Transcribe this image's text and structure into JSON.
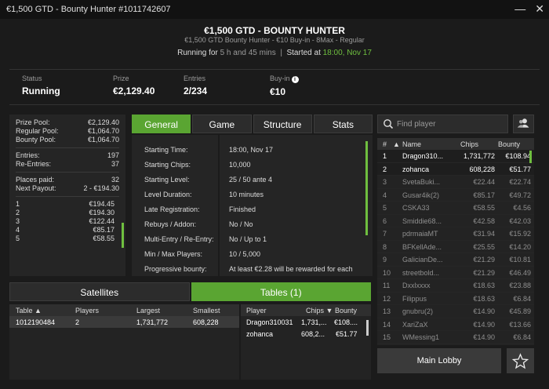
{
  "window": {
    "title": "€1,500 GTD - Bounty Hunter #1011742607",
    "minimize": "—",
    "close": "✕"
  },
  "header": {
    "title": "€1,500 GTD - BOUNTY HUNTER",
    "subtitle": "€1,500 GTD Bounty Hunter - €10 Buy-in - 8Max - Regular",
    "running_label": "Running for",
    "running_value": "5 h and 45 mins",
    "separator": "|",
    "started_label": "Started at",
    "started_value": "18:00, Nov 17"
  },
  "stats": [
    {
      "label": "Status",
      "value": "Running"
    },
    {
      "label": "Prize",
      "value": "€2,129.40"
    },
    {
      "label": "Entries",
      "value": "2/234"
    },
    {
      "label": "Buy-in",
      "value": "€10"
    }
  ],
  "prize_panel": {
    "pool": [
      {
        "label": "Prize Pool:",
        "value": "€2,129.40"
      },
      {
        "label": "Regular Pool:",
        "value": "€1,064.70"
      },
      {
        "label": "Bounty Pool:",
        "value": "€1,064.70"
      }
    ],
    "entries": [
      {
        "label": "Entries:",
        "value": "197"
      },
      {
        "label": "Re-Entries:",
        "value": "37"
      }
    ],
    "places": [
      {
        "label": "Places paid:",
        "value": "32"
      },
      {
        "label": "Next Payout:",
        "value": "2 - €194.30"
      }
    ],
    "payouts": [
      {
        "place": "1",
        "amount": "€194.45"
      },
      {
        "place": "2",
        "amount": "€194.30"
      },
      {
        "place": "3",
        "amount": "€122.44"
      },
      {
        "place": "4",
        "amount": "€85.17"
      },
      {
        "place": "5",
        "amount": "€58.55"
      }
    ]
  },
  "tabs": [
    "General",
    "Game",
    "Structure",
    "Stats"
  ],
  "general": [
    {
      "key": "Starting Time:",
      "value": "18:00, Nov 17"
    },
    {
      "key": "Starting Chips:",
      "value": "10,000"
    },
    {
      "key": "Starting Level:",
      "value": "25 / 50 ante 4"
    },
    {
      "key": "Level Duration:",
      "value": "10 minutes"
    },
    {
      "key": "Late Registration:",
      "value": "Finished"
    },
    {
      "key": "Rebuys / Addon:",
      "value": "No / No"
    },
    {
      "key": "Multi-Entry / Re-Entry:",
      "value": "No / Up to 1"
    },
    {
      "key": "Min / Max Players:",
      "value": "10 / 5,000"
    },
    {
      "key": "Progressive bounty:",
      "value": "At least €2.28 will be rewarded for each"
    }
  ],
  "bottom_tabs": [
    "Satellites",
    "Tables (1)"
  ],
  "tables": {
    "headers": {
      "table": "Table",
      "players": "Players",
      "largest": "Largest",
      "smallest": "Smallest",
      "sort_arrow": "▲"
    },
    "rows": [
      {
        "table": "1012190484",
        "players": "2",
        "largest": "1,731,772",
        "smallest": "608,228"
      }
    ]
  },
  "table_players": {
    "headers": {
      "player": "Player",
      "chips": "Chips",
      "bounty": "Bounty",
      "sort_arrow": "▼"
    },
    "rows": [
      {
        "player": "Dragon310031",
        "chips": "1,731,...",
        "bounty": "€108...."
      },
      {
        "player": "zohanca",
        "chips": "608,2...",
        "bounty": "€51.77"
      }
    ]
  },
  "search": {
    "placeholder": "Find player"
  },
  "ranking": {
    "headers": {
      "rank": "#",
      "sort_arrow": "▲",
      "name": "Name",
      "chips": "Chips",
      "bounty": "Bounty"
    },
    "rows": [
      {
        "rank": "1",
        "name": "Dragon310...",
        "chips": "1,731,772",
        "bounty": "€108.94",
        "active": true
      },
      {
        "rank": "2",
        "name": "zohanca",
        "chips": "608,228",
        "bounty": "€51.77",
        "active": true
      },
      {
        "rank": "3",
        "name": "SvetaBuki...",
        "chips": "€22.44",
        "bounty": "€22.74",
        "active": false
      },
      {
        "rank": "4",
        "name": "Gusar4ik(2)",
        "chips": "€85.17",
        "bounty": "€49.72",
        "active": false
      },
      {
        "rank": "5",
        "name": "CSKA33",
        "chips": "€58.55",
        "bounty": "€4.56",
        "active": false
      },
      {
        "rank": "6",
        "name": "Smiddie68...",
        "chips": "€42.58",
        "bounty": "€42.03",
        "active": false
      },
      {
        "rank": "7",
        "name": "pdrmaiaMT",
        "chips": "€31.94",
        "bounty": "€15.92",
        "active": false
      },
      {
        "rank": "8",
        "name": "BFKellAde...",
        "chips": "€25.55",
        "bounty": "€14.20",
        "active": false
      },
      {
        "rank": "9",
        "name": "GalicianDe...",
        "chips": "€21.29",
        "bounty": "€10.81",
        "active": false
      },
      {
        "rank": "10",
        "name": "streetbold...",
        "chips": "€21.29",
        "bounty": "€46.49",
        "active": false
      },
      {
        "rank": "11",
        "name": "Dxxlxxxx",
        "chips": "€18.63",
        "bounty": "€23.88",
        "active": false
      },
      {
        "rank": "12",
        "name": "Filippus",
        "chips": "€18.63",
        "bounty": "€6.84",
        "active": false
      },
      {
        "rank": "13",
        "name": "gnubru(2)",
        "chips": "€14.90",
        "bounty": "€45.89",
        "active": false
      },
      {
        "rank": "14",
        "name": "XariZaX",
        "chips": "€14.90",
        "bounty": "€13.66",
        "active": false
      },
      {
        "rank": "15",
        "name": "WMessing1",
        "chips": "€14.90",
        "bounty": "€6.84",
        "active": false
      }
    ]
  },
  "buttons": {
    "main_lobby": "Main Lobby"
  },
  "colors": {
    "accent": "#5aa532",
    "background": "#1b1b1b",
    "panel": "#252525"
  }
}
